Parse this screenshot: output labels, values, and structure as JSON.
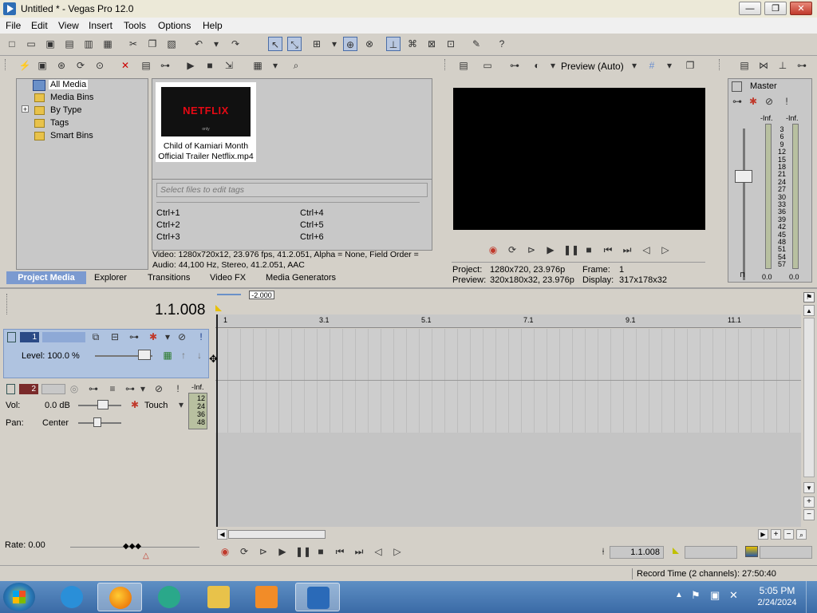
{
  "window": {
    "title": "Untitled * - Vegas Pro 12.0",
    "minimize": "—",
    "maximize": "❐",
    "close": "✕"
  },
  "menu": [
    "File",
    "Edit",
    "View",
    "Insert",
    "Tools",
    "Options",
    "Help"
  ],
  "media_panel": {
    "tree": [
      "All Media",
      "Media Bins",
      "By Type",
      "Tags",
      "Smart Bins"
    ],
    "tree_expander": "+",
    "thumb_logo": "NETFLIX",
    "thumb_sub": "only",
    "file_name_1": "Child of Kamiari Month",
    "file_name_2": "Official Trailer Netflix.mp4",
    "tags_placeholder": "Select files to edit tags",
    "shortcuts": [
      "Ctrl+1",
      "Ctrl+4",
      "Ctrl+2",
      "Ctrl+5",
      "Ctrl+3",
      "Ctrl+6"
    ],
    "video_info": "Video: 1280x720x12, 23.976 fps, 41.2.051, Alpha = None, Field Order =",
    "audio_info": "Audio: 44,100 Hz, Stereo, 41.2.051, AAC",
    "tabs": [
      "Project Media",
      "Explorer",
      "Transitions",
      "Video FX",
      "Media Generators"
    ]
  },
  "preview": {
    "mode": "Preview (Auto)",
    "project_label": "Project:",
    "project_value": "1280x720, 23.976p",
    "frame_label": "Frame:",
    "frame_value": "1",
    "preview_label": "Preview:",
    "preview_value": "320x180x32, 23.976p",
    "display_label": "Display:",
    "display_value": "317x178x32"
  },
  "master": {
    "label": "Master",
    "inf_left": "-Inf.",
    "inf_right": "-Inf.",
    "scale": [
      "3",
      "6",
      "9",
      "12",
      "15",
      "18",
      "21",
      "24",
      "27",
      "30",
      "33",
      "36",
      "39",
      "42",
      "45",
      "48",
      "51",
      "54",
      "57"
    ],
    "val_left": "0.0",
    "val_right": "0.0"
  },
  "timeline": {
    "time": "1.1.008",
    "marker": "-2.000",
    "ruler": [
      "1",
      "3.1",
      "5.1",
      "7.1",
      "9.1",
      "11.1"
    ],
    "track1_number": "1",
    "track1_level": "Level: 100.0 %",
    "track2_number": "2",
    "track2_vol_label": "Vol:",
    "track2_vol": "0.0 dB",
    "track2_pan_label": "Pan:",
    "track2_pan": "Center",
    "track2_mode": "Touch",
    "track2_meter_inf": "-Inf.",
    "track2_meter": [
      "12",
      "24",
      "36",
      "48"
    ],
    "rate": "Rate: 0.00",
    "transport_time": "1.1.008",
    "record_time": "Record Time (2 channels): 27:50:40"
  },
  "taskbar": {
    "time": "5:05 PM",
    "date": "2/24/2024"
  }
}
